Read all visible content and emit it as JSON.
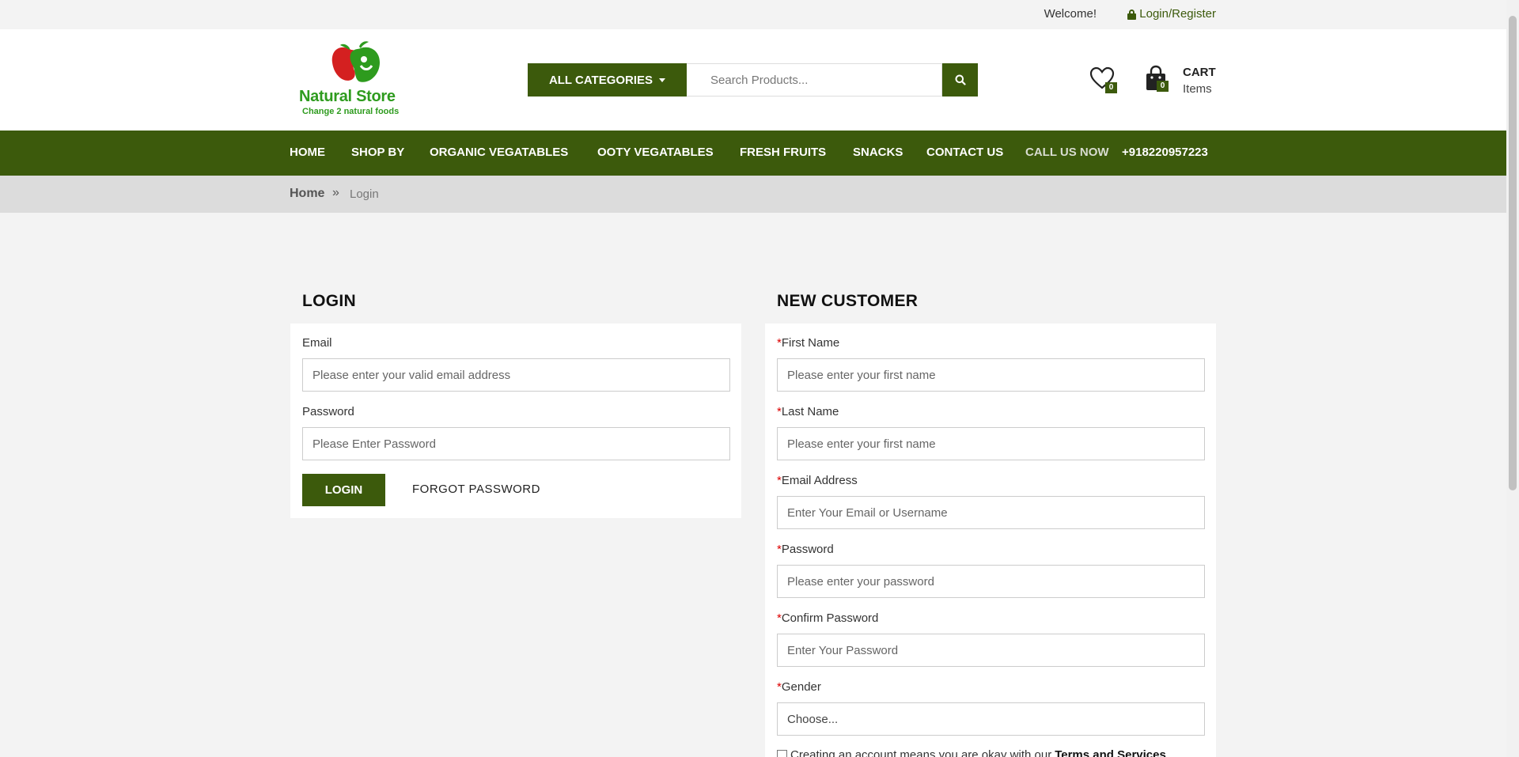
{
  "topbar": {
    "welcome": "Welcome!",
    "login_register": "Login/Register"
  },
  "logo": {
    "brand": "Natural Store",
    "tagline": "Change 2 natural foods"
  },
  "search": {
    "categories_label": "ALL CATEGORIES",
    "placeholder": "Search Products..."
  },
  "wishlist": {
    "count": "0"
  },
  "cart": {
    "count": "0",
    "label": "CART",
    "items_label": "Items"
  },
  "nav": {
    "items": [
      "HOME",
      "SHOP BY",
      "ORGANIC VEGATABLES",
      "OOTY VEGATABLES",
      "FRESH FRUITS",
      "SNACKS",
      "CONTACT US"
    ],
    "call_label": "CALL US NOW",
    "phone": "+918220957223"
  },
  "breadcrumb": {
    "home": "Home",
    "separator": "»",
    "current": "Login"
  },
  "login": {
    "title": "LOGIN",
    "email_label": "Email",
    "email_placeholder": "Please enter your valid email address",
    "password_label": "Password",
    "password_placeholder": "Please Enter Password",
    "login_button": "LOGIN",
    "forgot_link": "FORGOT PASSWORD"
  },
  "register": {
    "title": "NEW CUSTOMER",
    "required_mark": "*",
    "first_name_label": "First Name",
    "first_name_placeholder": "Please enter your first name",
    "last_name_label": "Last Name",
    "last_name_placeholder": "Please enter your first name",
    "email_label": "Email Address",
    "email_placeholder": "Enter Your Email or Username",
    "password_label": "Password",
    "password_placeholder": "Please enter your password",
    "confirm_label": "Confirm Password",
    "confirm_placeholder": "Enter Your Password",
    "gender_label": "Gender",
    "gender_value": "Choose...",
    "terms_text": "Creating an account means you are okay with our",
    "terms_link": "Terms and Services"
  },
  "colors": {
    "brand_green": "#3c5a0c",
    "logo_green": "#2e9b1e",
    "required_red": "#dd0000"
  }
}
